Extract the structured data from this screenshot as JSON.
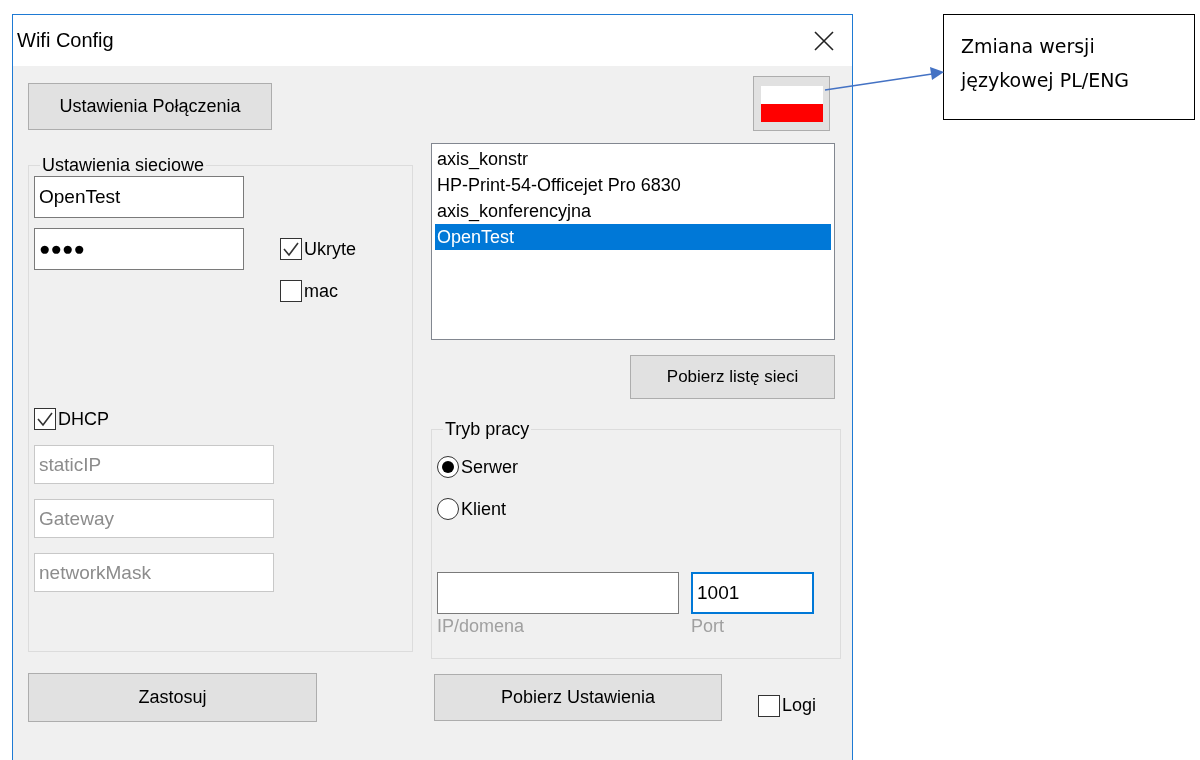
{
  "window": {
    "title": "Wifi Config"
  },
  "connection_button": "Ustawienia Połączenia",
  "network_group": {
    "title": "Ustawienia sieciowe",
    "ssid": "OpenTest",
    "password": "●●●●",
    "options": [
      {
        "label": "Ukryte",
        "checked": true
      },
      {
        "label": "mac",
        "checked": false
      }
    ],
    "dhcp": {
      "label": "DHCP",
      "checked": true
    },
    "static_fields": [
      {
        "placeholder": "staticIP"
      },
      {
        "placeholder": "Gateway"
      },
      {
        "placeholder": "networkMask"
      }
    ]
  },
  "networks": [
    {
      "name": "axis_konstr",
      "selected": false
    },
    {
      "name": "HP-Print-54-Officejet Pro 6830",
      "selected": false
    },
    {
      "name": "axis_konferencyjna",
      "selected": false
    },
    {
      "name": "OpenTest",
      "selected": true
    }
  ],
  "fetch_list_button": "Pobierz listę sieci",
  "mode_group": {
    "title": "Tryb pracy",
    "options": [
      {
        "label": "Serwer",
        "selected": true
      },
      {
        "label": "Klient",
        "selected": false
      }
    ],
    "address": {
      "label": "IP/domena",
      "focused": false
    },
    "port": {
      "label": "Port",
      "value": "1001",
      "focused": true
    }
  },
  "apply_button": "Zastosuj",
  "get_settings_button": "Pobierz Ustawienia",
  "logs": {
    "label": "Logi",
    "checked": false
  },
  "annotation": {
    "text": "Zmiana wersji\njęzykowej PL/ENG"
  }
}
